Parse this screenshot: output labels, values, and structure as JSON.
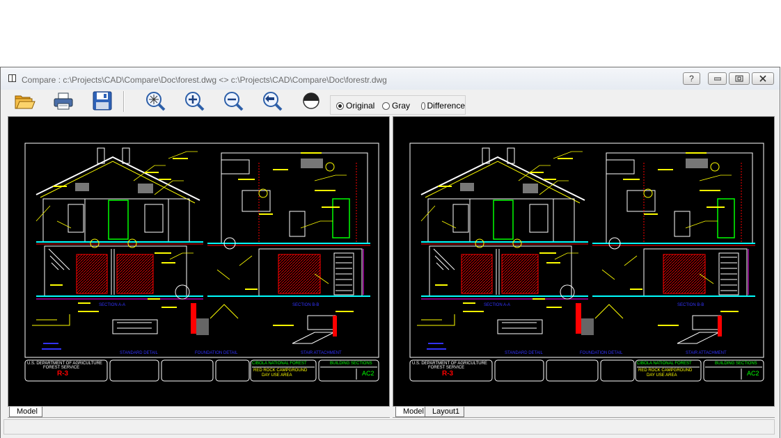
{
  "window": {
    "title": "Compare : c:\\Projects\\CAD\\Compare\\Doc\\forest.dwg <> c:\\Projects\\CAD\\Compare\\Doc\\forestr.dwg",
    "help_label": "?",
    "minimize_label": "▭",
    "maximize_label": "▢",
    "close_label": "✕"
  },
  "toolbar": {
    "buttons": [
      {
        "name": "open",
        "icon": "folder-open-icon"
      },
      {
        "name": "print",
        "icon": "printer-icon"
      },
      {
        "name": "save",
        "icon": "floppy-disk-icon"
      },
      {
        "name": "zoom-extents",
        "icon": "zoom-extents-icon"
      },
      {
        "name": "zoom-in",
        "icon": "zoom-in-icon"
      },
      {
        "name": "zoom-out",
        "icon": "zoom-out-icon"
      },
      {
        "name": "zoom-previous",
        "icon": "zoom-previous-icon"
      },
      {
        "name": "contrast",
        "icon": "contrast-icon"
      }
    ],
    "display_mode": {
      "options": [
        "Original",
        "Gray",
        "Difference"
      ],
      "selected": "Original"
    }
  },
  "left_pane": {
    "tabs": [
      "Model"
    ],
    "active_tab": "Model"
  },
  "right_pane": {
    "tabs": [
      "Model",
      "Layout1"
    ],
    "active_tab": "Model"
  },
  "drawing": {
    "title_block": {
      "agency_line1": "U.S. DEPARTMENT OF AGRICULTURE",
      "agency_line2": "FOREST SERVICE",
      "region": "R-3",
      "forest": "CIBOLA NATIONAL FOREST",
      "site_line1": "RED ROCK CAMPGROUND",
      "site_line2": "DAY USE AREA",
      "sheet_title": "BUILDING SECTIONS",
      "sheet_number": "AC2"
    },
    "section_labels": [
      "SECTION A-A",
      "SECTION B-B"
    ],
    "detail_labels": [
      "STANDARD DETAIL",
      "FOUNDATION DETAIL",
      "STAIR ATTACHMENT"
    ],
    "colors": {
      "background": "#000000",
      "linework": "#ffffff",
      "annotation": "#ffff00",
      "section": "#ff0000",
      "title": "#00ff00",
      "labels": "#3333ff",
      "highlight": "#ff00ff",
      "water": "#00ffff"
    }
  }
}
